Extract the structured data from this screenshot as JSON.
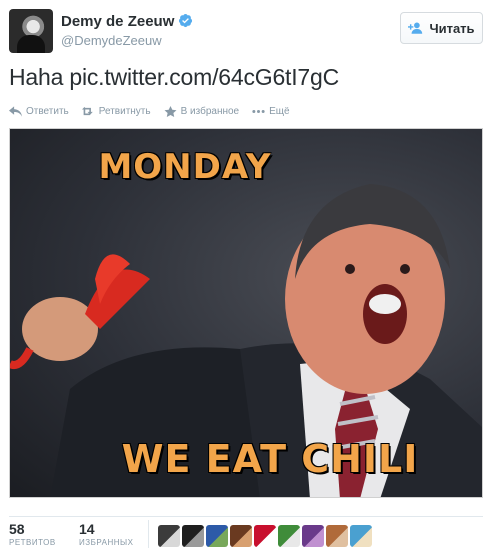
{
  "user": {
    "display_name": "Demy de Zeeuw",
    "handle": "@DemydeZeeuw",
    "verified": true
  },
  "follow_button": {
    "label": "Читать",
    "icon": "add-user-icon"
  },
  "tweet": {
    "text": "Haha pic.twitter.com/64cG6tI7gC"
  },
  "actions": [
    {
      "id": "reply",
      "label": "Ответить",
      "icon": "reply-icon"
    },
    {
      "id": "retweet",
      "label": "Ретвитнуть",
      "icon": "retweet-icon"
    },
    {
      "id": "favorite",
      "label": "В избранное",
      "icon": "star-icon"
    },
    {
      "id": "more",
      "label": "Ещё",
      "icon": "more-dots-icon"
    }
  ],
  "image": {
    "top_caption": "MONDAY",
    "bottom_caption": "WE EAT CHILI"
  },
  "stats": {
    "retweets": {
      "count": "58",
      "label": "РЕТВИТОВ"
    },
    "favorites": {
      "count": "14",
      "label": "ИЗБРАННЫХ"
    }
  },
  "colors": {
    "verified_blue": "#55acee",
    "caption_orange": "#f2a54a",
    "muted_text": "#8899a6"
  },
  "favoriters": [
    {
      "color_a": "#3b3b3b",
      "color_b": "#d8d8d8"
    },
    {
      "color_a": "#1f1f1f",
      "color_b": "#9a9a9a"
    },
    {
      "color_a": "#2d5aa8",
      "color_b": "#78a85a"
    },
    {
      "color_a": "#6a3a20",
      "color_b": "#d8a070"
    },
    {
      "color_a": "#c8102e",
      "color_b": "#ffffff"
    },
    {
      "color_a": "#3f8c3a",
      "color_b": "#e8e8e8"
    },
    {
      "color_a": "#6a3a8a",
      "color_b": "#c090d0"
    },
    {
      "color_a": "#b06a3a",
      "color_b": "#e0c0a0"
    },
    {
      "color_a": "#4aa0d0",
      "color_b": "#f0e0c0"
    }
  ]
}
